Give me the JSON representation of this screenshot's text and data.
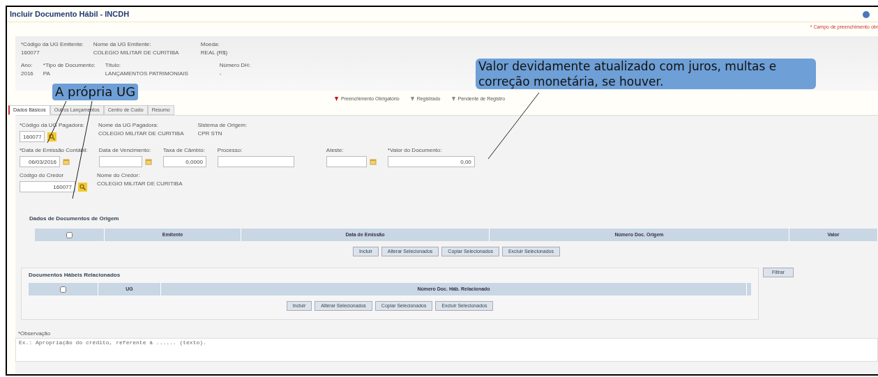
{
  "window": {
    "title": "Incluir Documento Hábil - INCDH"
  },
  "required_note": "* Campo de preenchimento obr",
  "header_rows": [
    [
      {
        "label": "*Código da UG Emitente:",
        "value": "160077"
      },
      {
        "label": "Nome da UG Emitente:",
        "value": "COLEGIO MILITAR DE CURITIBA"
      },
      {
        "label": "Moeda:",
        "value": "REAL (R$)"
      }
    ],
    [
      {
        "label": "Ano:",
        "value": "2016"
      },
      {
        "label": "*Tipo de Documento:",
        "value": "PA"
      },
      {
        "label": "Título:",
        "value": "LANÇAMENTOS PATRIMONIAIS"
      },
      {
        "label": "Número DH:",
        "value": "-"
      }
    ]
  ],
  "legend": [
    {
      "label": "Preenchimento Obrigatório",
      "color": "#cc0000"
    },
    {
      "label": "Registrado",
      "color": "#888888"
    },
    {
      "label": "Pendente de Registro",
      "color": "#888888"
    }
  ],
  "tabs": [
    {
      "label": "Dados Básicos",
      "selected": true
    },
    {
      "label": "Outros Lançamentos",
      "selected": false
    },
    {
      "label": "Centro de Custo",
      "selected": false
    },
    {
      "label": "Resumo",
      "selected": false
    }
  ],
  "field_rows": [
    [
      {
        "kind": "lookup",
        "label": "*Código da UG Pagadora:",
        "value": "160077"
      },
      {
        "kind": "text",
        "label": "Nome da UG Pagadora:",
        "value": "COLEGIO MILITAR DE CURITIBA"
      },
      {
        "kind": "text",
        "label": "Sistema de Origem:",
        "value": "CPR STN"
      }
    ],
    [
      {
        "kind": "date",
        "label": "*Data de Emissão Contábil:",
        "value": "06/03/2016"
      },
      {
        "kind": "date",
        "label": "Data de Vencimento:"
      },
      {
        "kind": "input",
        "label": "Taxa de Câmbio:",
        "value": "0,0000"
      },
      {
        "kind": "input",
        "label": "Processo:"
      },
      {
        "kind": "date",
        "label": "Ateste:"
      },
      {
        "kind": "input",
        "label": "*Valor do Documento:",
        "value": "0,00"
      }
    ],
    [
      {
        "kind": "lookup",
        "label": "Código do Credor",
        "value": "160077"
      },
      {
        "kind": "text",
        "label": "Nome do Credor:",
        "value": "COLEGIO MILITAR DE CURITIBA"
      }
    ]
  ],
  "origin_docs": {
    "title": "Dados de Documentos de Origem",
    "select_all": {
      "checked": false
    },
    "columns": [
      "Emitente",
      "Data de Emissão",
      "Número Doc. Origem",
      "Valor"
    ],
    "buttons": [
      "Incluir",
      "Alterar Selecionados",
      "Copiar Selecionados",
      "Excluir Selecionados"
    ]
  },
  "related_docs": {
    "title": "Documentos Hábeis Relacionados",
    "select_all": {
      "checked": false
    },
    "columns": [
      "UG",
      "Número Doc. Háb. Relacionado"
    ],
    "buttons": [
      "Incluir",
      "Alterar Selecionados",
      "Copiar Selecionados",
      "Excluir Selecionados"
    ],
    "side_button": "Filtrar"
  },
  "observation": {
    "label": "*Observação",
    "placeholder": "Ex.: Apropriação do crédito, referente à ...... (texto)."
  },
  "callouts": [
    {
      "text": "A própria UG"
    },
    {
      "text": "Valor devidamente atualizado com juros, multas e correção monetária, se houver."
    }
  ]
}
